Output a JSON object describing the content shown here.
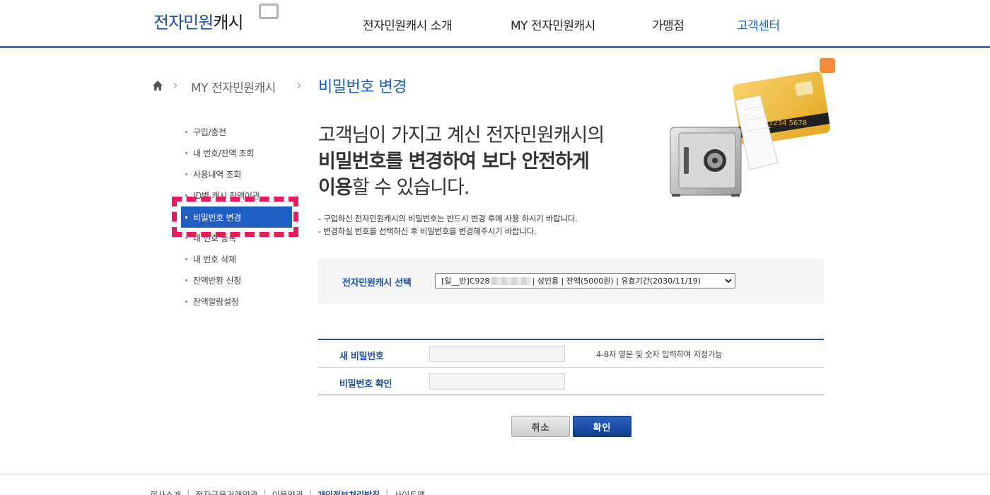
{
  "header": {
    "logo_main": "전자민원",
    "logo_sub": "캐시",
    "nav": [
      {
        "label": "전자민원캐시 소개"
      },
      {
        "label": "MY 전자민원캐시"
      },
      {
        "label": "가맹점"
      },
      {
        "label": "고객센터"
      }
    ]
  },
  "breadcrumb": {
    "section": "MY 전자민원캐시",
    "current": "비밀번호 변경"
  },
  "sidebar": {
    "items": [
      {
        "label": "구입/충전"
      },
      {
        "label": "내 번호/잔액 조회"
      },
      {
        "label": "사용내역 조회"
      },
      {
        "label": "ID별 캐시 잔액이관"
      },
      {
        "label": "비밀번호 변경"
      },
      {
        "label": "내 번호 등록"
      },
      {
        "label": "내 번호 삭제"
      },
      {
        "label": "잔액반환 신청"
      },
      {
        "label": "잔액알람설정"
      }
    ]
  },
  "headline": {
    "line1": "고객님이 가지고 계신 전자민원캐시의",
    "line2": "비밀번호를 변경하여 보다 안전하게",
    "line3_bold": "이용",
    "line3_rest": "할 수 있습니다."
  },
  "notes": [
    "- 구입하신 전자민원캐시의 비밀번호는 반드시 변경 후에 사용 하시기 바랍니다.",
    "- 변경하실 번호를 선택하신 후 비밀번호를 변경해주시기 바랍니다."
  ],
  "illustration": {
    "card_number": "1234 5678"
  },
  "cash_select": {
    "label": "전자민원캐시 선택",
    "value_prefix": "[일__반]C928",
    "value_suffix": "| 성인용 | 잔액(5000원) | 유효기간(2030/11/19)"
  },
  "form": {
    "new_password_label": "새 비밀번호",
    "new_password_hint": "4-8자 영문 및 숫자 입력하여 지정가능",
    "confirm_password_label": "비밀번호 확인"
  },
  "buttons": {
    "cancel": "취소",
    "ok": "확인"
  },
  "footer": {
    "links": [
      "회사소개",
      "전자금융거래약관",
      "이용약관",
      "개인정보처리방침",
      "사이트맵"
    ]
  },
  "colors": {
    "brand_blue": "#1b5fc1",
    "highlight": "#e8195e",
    "header_rule": "#3a6fc4"
  }
}
